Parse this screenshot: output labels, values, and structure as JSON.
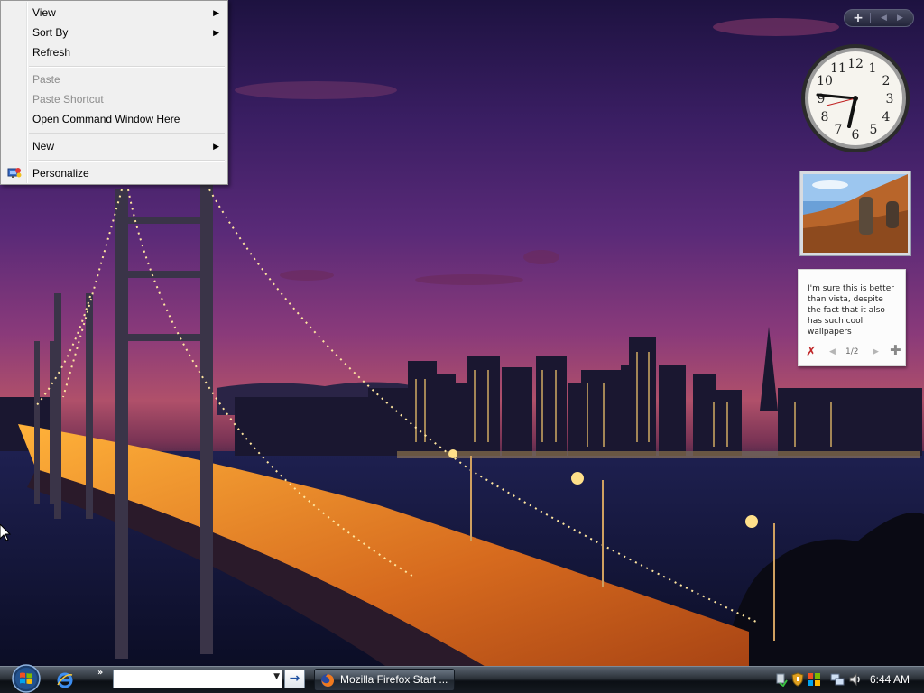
{
  "context_menu": {
    "items": [
      {
        "label": "View",
        "submenu": true
      },
      {
        "label": "Sort By",
        "submenu": true
      },
      {
        "label": "Refresh"
      },
      {
        "label": "Paste",
        "disabled": true
      },
      {
        "label": "Paste Shortcut",
        "disabled": true
      },
      {
        "label": "Open Command Window Here"
      },
      {
        "label": "New",
        "submenu": true
      },
      {
        "label": "Personalize",
        "icon": "personalize-icon"
      }
    ]
  },
  "sidebar": {
    "add_gadget_label": "+",
    "clock": {
      "hour": 6,
      "minute": 44
    },
    "notes": {
      "text": "I'm sure this is better than vista, despite the fact that it also has such cool wallpapers",
      "page": "1/2"
    }
  },
  "taskbar": {
    "address_value": "",
    "go_label": "→",
    "tasks": [
      {
        "label": "Mozilla Firefox Start ...",
        "icon": "firefox-icon"
      }
    ],
    "tray": {
      "icons": [
        "network-sync-icon",
        "security-shield-icon",
        "windows-update-icon",
        "network-icon",
        "volume-icon"
      ],
      "time": "6:44 AM"
    }
  },
  "colors": {
    "menu_bg": "#f0f0f0",
    "taskbar": "#1a1f26",
    "sky": "#5a2a78"
  }
}
